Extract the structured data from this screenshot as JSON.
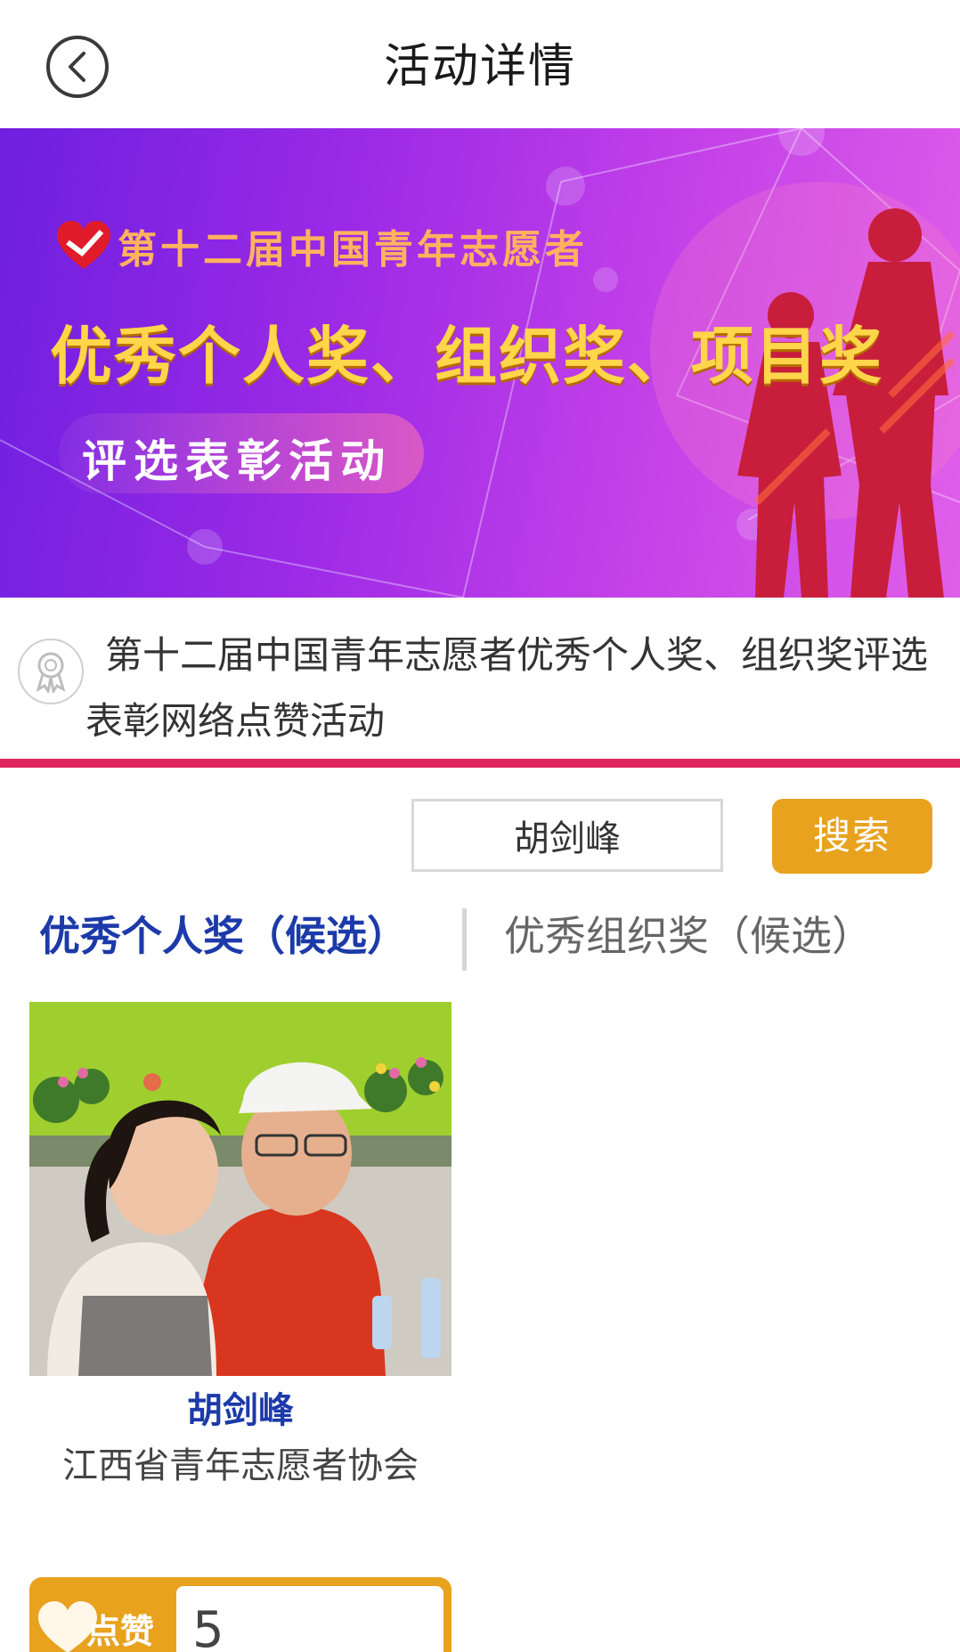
{
  "header": {
    "title": "活动详情",
    "back_icon": "chevron-left-icon"
  },
  "banner": {
    "line1": "第十二届中国青年志愿者",
    "line2": "优秀个人奖、组织奖、项目奖",
    "line3": "评选表彰活动"
  },
  "activity": {
    "title": "第十二届中国青年志愿者优秀个人奖、组织奖评选表彰网络点赞活动",
    "icon": "award-ribbon-icon"
  },
  "search": {
    "value": "胡剑峰",
    "button_label": "搜索"
  },
  "tabs": [
    {
      "label": "优秀个人奖（候选）",
      "active": true
    },
    {
      "label": "优秀组织奖（候选）",
      "active": false
    }
  ],
  "candidates": [
    {
      "name": "胡剑峰",
      "organization": "江西省青年志愿者协会",
      "like_label": "点赞",
      "like_count": "5"
    }
  ],
  "colors": {
    "accent_blue": "#1c3aa9",
    "accent_orange": "#e8a21e",
    "divider_pink": "#e0245e"
  }
}
